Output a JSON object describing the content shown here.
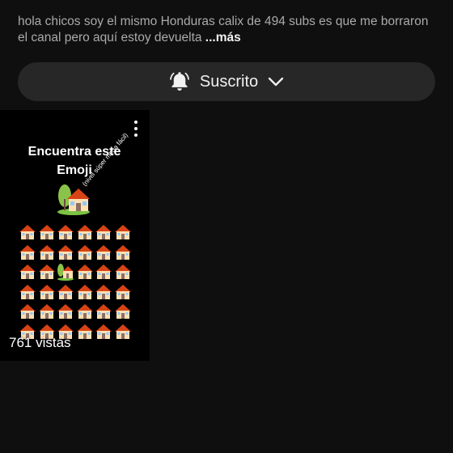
{
  "description": {
    "text": "hola chicos soy el mismo Honduras calix de 494 subs es que me borraron el canal pero aquí estoy devuelta ",
    "more_label": "...más"
  },
  "subscribe_button": {
    "label": "Suscrito",
    "bell_icon": "bell-icon",
    "chevron_icon": "chevron-down-icon"
  },
  "short": {
    "title_line1": "Encuentra este",
    "title_line2": "Emoji",
    "hint": "(nivel súper mega fácil)",
    "views": "761 vistas",
    "grid": {
      "rows": 6,
      "cols": 6,
      "odd_row": 2,
      "odd_col": 2,
      "emoji_icon": "house-icon",
      "odd_icon": "house-with-garden-icon"
    }
  }
}
